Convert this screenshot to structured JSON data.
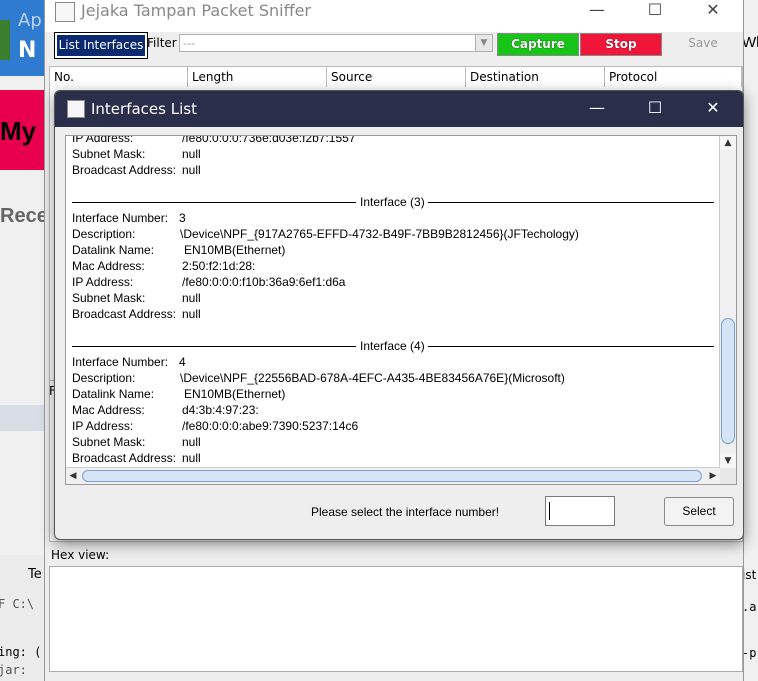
{
  "background": {
    "blue_app_text_top": "Ap",
    "blue_app_text_bottom": "N",
    "pink_text": "My",
    "rece_text": "Rece",
    "right_top_text": "Wh",
    "right_mid_text": "ist",
    "left_tab_text": "Te",
    "left_code_1": "F C:\\",
    "left_code_2": "ing: (",
    "left_code_3": "jar:",
    "right_code_1": ".a",
    "right_code_2": "-p",
    "f_fragment": "F"
  },
  "main_window": {
    "title": "Jejaka Tampan Packet Sniffer",
    "controls": {
      "minimize": "—",
      "maximize": "☐",
      "close": "✕"
    },
    "toolbar": {
      "list_interfaces_label": "List Interfaces",
      "filter_label": "Filter",
      "filter_value": "---",
      "capture_label": "Capture",
      "stop_label": "Stop",
      "save_label": "Save"
    },
    "table": {
      "columns": [
        "No.",
        "Length",
        "Source",
        "Destination",
        "Protocol"
      ]
    },
    "hex_view_label": "Hex view:"
  },
  "dialog": {
    "title": "Interfaces List",
    "controls": {
      "minimize": "—",
      "maximize": "☐",
      "close": "✕"
    },
    "partial_top": {
      "ip_label": "IP Address:",
      "ip_value": "/fe80:0:0:0:736e:d03e:f2b7:1557",
      "subnet_label": "Subnet Mask:",
      "subnet_value": "null",
      "broadcast_label": "Broadcast Address:",
      "broadcast_value": "null"
    },
    "interfaces": [
      {
        "header": "Interface (3)",
        "number_label": "Interface Number:",
        "number_value": "3",
        "description_label": "Description:",
        "description_value": "\\Device\\NPF_{917A2765-EFFD-4732-B49F-7BB9B2812456}(JFTechology)",
        "datalink_label": "Datalink Name:",
        "datalink_value": "EN10MB(Ethernet)",
        "mac_label": "Mac Address:",
        "mac_value": "2:50:f2:1d:28:",
        "ip_label": "IP Address:",
        "ip_value": "/fe80:0:0:0:f10b:36a9:6ef1:d6a",
        "subnet_label": "Subnet Mask:",
        "subnet_value": "null",
        "broadcast_label": "Broadcast Address:",
        "broadcast_value": "null"
      },
      {
        "header": "Interface (4)",
        "number_label": "Interface Number:",
        "number_value": "4",
        "description_label": "Description:",
        "description_value": "\\Device\\NPF_{22556BAD-678A-4EFC-A435-4BE83456A76E}(Microsoft)",
        "datalink_label": "Datalink Name:",
        "datalink_value": "EN10MB(Ethernet)",
        "mac_label": "Mac Address:",
        "mac_value": "d4:3b:4:97:23:",
        "ip_label": "IP Address:",
        "ip_value": "/fe80:0:0:0:abe9:7390:5237:14c6",
        "subnet_label": "Subnet Mask:",
        "subnet_value": "null",
        "broadcast_label": "Broadcast Address:",
        "broadcast_value": "null"
      }
    ],
    "prompt": "Please select the interface number!",
    "input_value": "",
    "select_button_label": "Select",
    "scroll": {
      "up": "▲",
      "down": "▼",
      "left": "◀",
      "right": "▶"
    }
  }
}
